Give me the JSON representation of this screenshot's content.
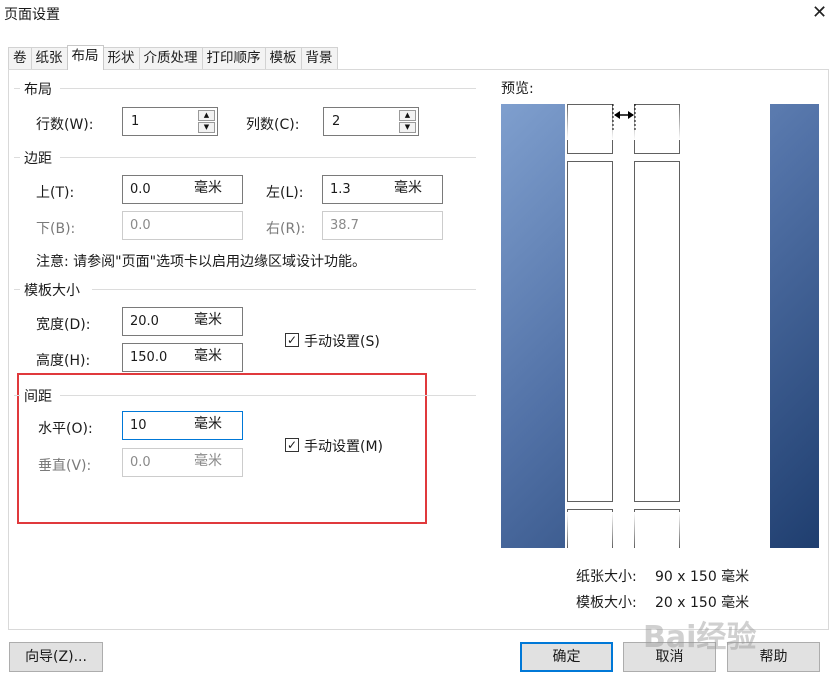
{
  "window": {
    "title": "页面设置",
    "close": "✕"
  },
  "tabs": [
    "卷",
    "纸张",
    "布局",
    "形状",
    "介质处理",
    "打印顺序",
    "模板",
    "背景"
  ],
  "active_tab": "布局",
  "layout_group": {
    "title": "布局",
    "rows_label": "行数(W):",
    "rows_value": "1",
    "cols_label": "列数(C):",
    "cols_value": "2"
  },
  "margins_group": {
    "title": "边距",
    "top_label": "上(T):",
    "top_value": "0.0",
    "top_unit": "毫米",
    "left_label": "左(L):",
    "left_value": "1.3",
    "left_unit": "毫米",
    "bottom_label": "下(B):",
    "bottom_value": "0.0",
    "right_label": "右(R):",
    "right_value": "38.7",
    "note": "注意: 请参阅\"页面\"选项卡以启用边缘区域设计功能。"
  },
  "template_size_group": {
    "title": "模板大小",
    "width_label": "宽度(D):",
    "width_value": "20.0",
    "width_unit": "毫米",
    "height_label": "高度(H):",
    "height_value": "150.0",
    "height_unit": "毫米",
    "manual_label": "手动设置(S)",
    "manual_checked": true
  },
  "spacing_group": {
    "title": "间距",
    "horizontal_label": "水平(O):",
    "horizontal_value": "10",
    "horizontal_unit": "毫米",
    "vertical_label": "垂直(V):",
    "vertical_value": "0.0",
    "vertical_unit": "毫米",
    "manual_label": "手动设置(M)",
    "manual_checked": true
  },
  "preview": {
    "label": "预览:",
    "paper_size_label": "纸张大小:",
    "paper_size_value": "90 x 150 毫米",
    "template_size_label": "模板大小:",
    "template_size_value": "20 x 150 毫米"
  },
  "buttons": {
    "wizard": "向导(Z)...",
    "ok": "确定",
    "cancel": "取消",
    "help": "帮助"
  },
  "watermark": "Bai经验",
  "colors": {
    "highlight_box": "#e0393c",
    "focus_border": "#0078d7",
    "preview_bg": "#4a6aa0"
  }
}
